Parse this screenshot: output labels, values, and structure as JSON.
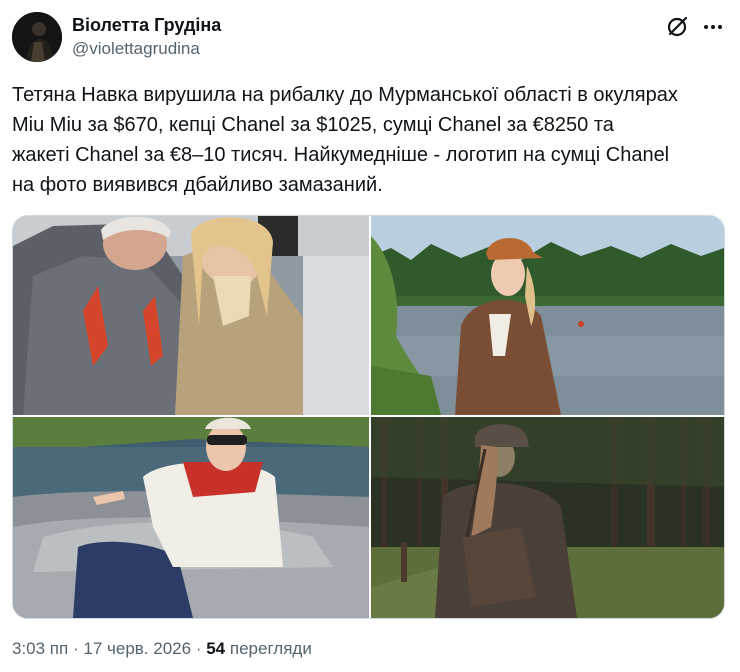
{
  "author": {
    "display_name": "Віолетта Грудіна",
    "handle": "@violettagrudina"
  },
  "icons": {
    "grok": "grok-slash-circle-icon",
    "more": "more-horizontal-icon"
  },
  "tweet": {
    "text": "Тетяна Навка вирушила на рибалку до Мурманської області в окулярах\nMiu Miu за $670, кепці Chanel за $1025, сумці Chanel за €8250 та\nжакеті Chanel за €8–10 тисяч. Найкумедніше - логотип на сумці Chanel\nна фото виявився дбайливо замазаний."
  },
  "media": {
    "photo_count": 4
  },
  "meta": {
    "time": "3:03 пп",
    "separator": "·",
    "date": "17 черв. 2026",
    "views_count": "54",
    "views_label": "перегляди"
  },
  "colors": {
    "text": "#0f1419",
    "secondary": "#536471",
    "border": "#cfd9de"
  }
}
